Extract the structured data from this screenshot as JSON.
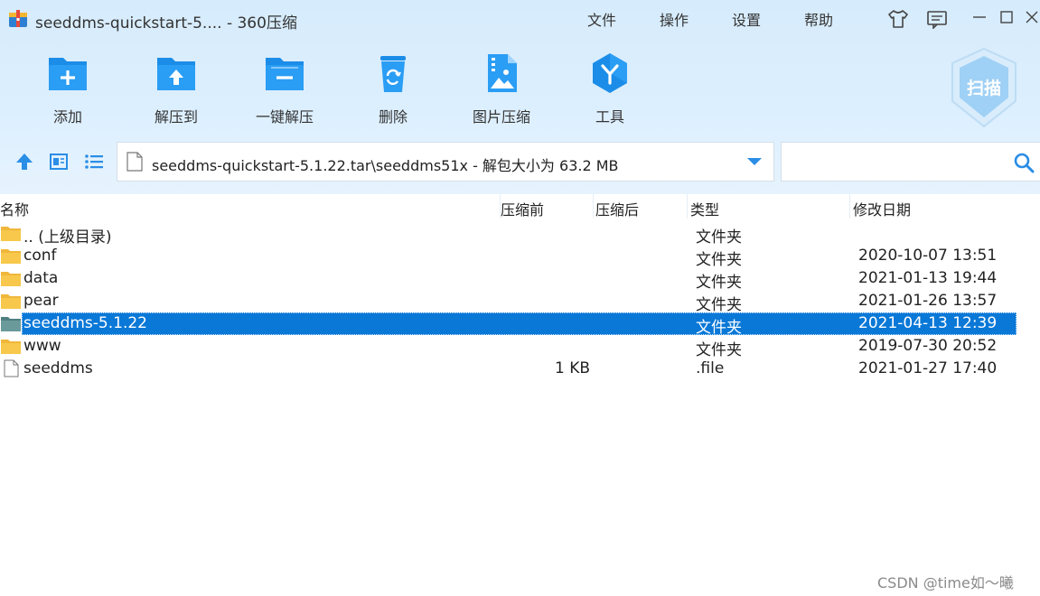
{
  "window": {
    "title": "seeddms-quickstart-5.... - 360压缩"
  },
  "menu": [
    "文件",
    "操作",
    "设置",
    "帮助"
  ],
  "toolbar": {
    "add": "添加",
    "extract_to": "解压到",
    "one_click_extract": "一键解压",
    "delete": "删除",
    "image_compress": "图片压缩",
    "tools": "工具",
    "scan": "扫描"
  },
  "address": {
    "path": "seeddms-quickstart-5.1.22.tar\\seeddms51x - 解包大小为 63.2 MB"
  },
  "search": {
    "value": ""
  },
  "columns": {
    "name": "名称",
    "before": "压缩前",
    "after": "压缩后",
    "type": "类型",
    "modified": "修改日期"
  },
  "files": [
    {
      "name": ".. (上级目录)",
      "size": "",
      "type": "文件夹",
      "date": "",
      "icon": "folder-icon"
    },
    {
      "name": "conf",
      "size": "",
      "type": "文件夹",
      "date": "2020-10-07 13:51",
      "icon": "folder-icon"
    },
    {
      "name": "data",
      "size": "",
      "type": "文件夹",
      "date": "2021-01-13 19:44",
      "icon": "folder-icon"
    },
    {
      "name": "pear",
      "size": "",
      "type": "文件夹",
      "date": "2021-01-26 13:57",
      "icon": "folder-icon"
    },
    {
      "name": "seeddms-5.1.22",
      "size": "",
      "type": "文件夹",
      "date": "2021-04-13 12:39",
      "icon": "folder-icon",
      "selected": true
    },
    {
      "name": "www",
      "size": "",
      "type": "文件夹",
      "date": "2019-07-30 20:52",
      "icon": "folder-icon"
    },
    {
      "name": "seeddms",
      "size": "1 KB",
      "type": ".file",
      "date": "2021-01-27 17:40",
      "icon": "file-icon"
    }
  ],
  "watermark": "CSDN @time如～曦",
  "colors": {
    "accent": "#1a8fe6",
    "selection": "#0a78d7",
    "folder": "#f5c242"
  }
}
